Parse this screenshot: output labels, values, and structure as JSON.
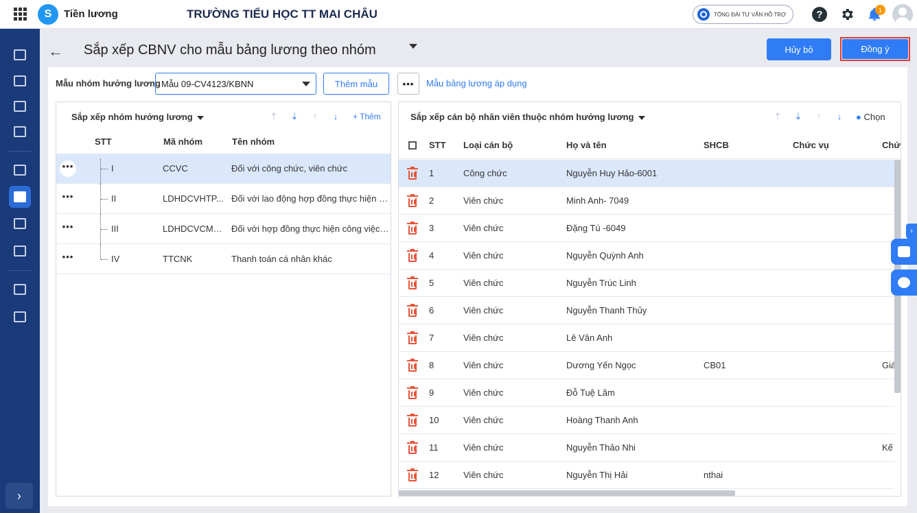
{
  "app": {
    "name": "Tiền lương",
    "logo_letter": "S",
    "school": "TRƯỜNG TIỂU HỌC TT MAI CHÂU",
    "hotline": "TỔNG ĐÀI TƯ VẤN HỖ TRỢ",
    "notification_count": "1",
    "help_symbol": "?"
  },
  "header": {
    "title": "Sắp xếp CBNV cho mẫu bảng lương theo nhóm",
    "cancel": "Hủy bỏ",
    "ok": "Đồng ý"
  },
  "filter": {
    "label": "Mẫu nhóm hưởng lương",
    "value": "Mẫu 09-CV4123/KBNN",
    "add_template": "Thêm mẫu",
    "more": "•••",
    "applied_link": "Mẫu bảng lương áp dụng"
  },
  "left_panel": {
    "title": "Sắp xếp nhóm hưởng lương",
    "add": "+ Thêm",
    "columns": [
      "STT",
      "Mã nhóm",
      "Tên nhóm"
    ],
    "rows": [
      {
        "stt": "I",
        "code": "CCVC",
        "name": "Đối với công chức, viên chức"
      },
      {
        "stt": "II",
        "code": "LDHDCVHTP...",
        "name": "Đối với lao động hợp đồng thực hiện c..."
      },
      {
        "stt": "III",
        "code": "LDHDCVCMN...",
        "name": "Đối với hợp đồng thực hiện công việc ..."
      },
      {
        "stt": "IV",
        "code": "TTCNK",
        "name": "Thanh toán cá nhân khác"
      }
    ]
  },
  "right_panel": {
    "title": "Sắp xếp cán bộ nhân viên thuộc nhóm hưởng lương",
    "choose": "Chọn",
    "columns": [
      "STT",
      "Loại cán bộ",
      "Họ và tên",
      "SHCB",
      "Chức vụ",
      "Chức"
    ],
    "rows": [
      {
        "stt": "1",
        "type": "Công chức",
        "name": "Nguyễn Huy Hảo-6001",
        "shcb": "",
        "extra": ""
      },
      {
        "stt": "2",
        "type": "Viên chức",
        "name": "Minh Anh- 7049",
        "shcb": "",
        "extra": ""
      },
      {
        "stt": "3",
        "type": "Viên chức",
        "name": "Đặng Tú -6049",
        "shcb": "",
        "extra": ""
      },
      {
        "stt": "4",
        "type": "Viên chức",
        "name": "Nguyễn Quỳnh Anh",
        "shcb": "",
        "extra": ""
      },
      {
        "stt": "5",
        "type": "Viên chức",
        "name": "Nguyễn Trúc Linh",
        "shcb": "",
        "extra": ""
      },
      {
        "stt": "6",
        "type": "Viên chức",
        "name": "Nguyễn Thanh Thủy",
        "shcb": "",
        "extra": ""
      },
      {
        "stt": "7",
        "type": "Viên chức",
        "name": "Lê Vân Anh",
        "shcb": "",
        "extra": ""
      },
      {
        "stt": "8",
        "type": "Viên chức",
        "name": "Dương Yến Ngọc",
        "shcb": "CB01",
        "extra": "Giá"
      },
      {
        "stt": "9",
        "type": "Viên chức",
        "name": "Đỗ Tuệ Lâm",
        "shcb": "",
        "extra": ""
      },
      {
        "stt": "10",
        "type": "Viên chức",
        "name": "Hoàng Thanh Anh",
        "shcb": "",
        "extra": ""
      },
      {
        "stt": "11",
        "type": "Viên chức",
        "name": "Nguyễn Thảo Nhi",
        "shcb": "",
        "extra": "Kế"
      },
      {
        "stt": "12",
        "type": "Viên chức",
        "name": "Nguyễn Thị Hải",
        "shcb": "nthai",
        "extra": ""
      }
    ]
  },
  "icons": {
    "back": "←",
    "nav_expand": "›",
    "side_tab": "›",
    "sort_up": "⇡",
    "sort_down": "⇣",
    "move_up": "↑",
    "move_down": "↓"
  }
}
